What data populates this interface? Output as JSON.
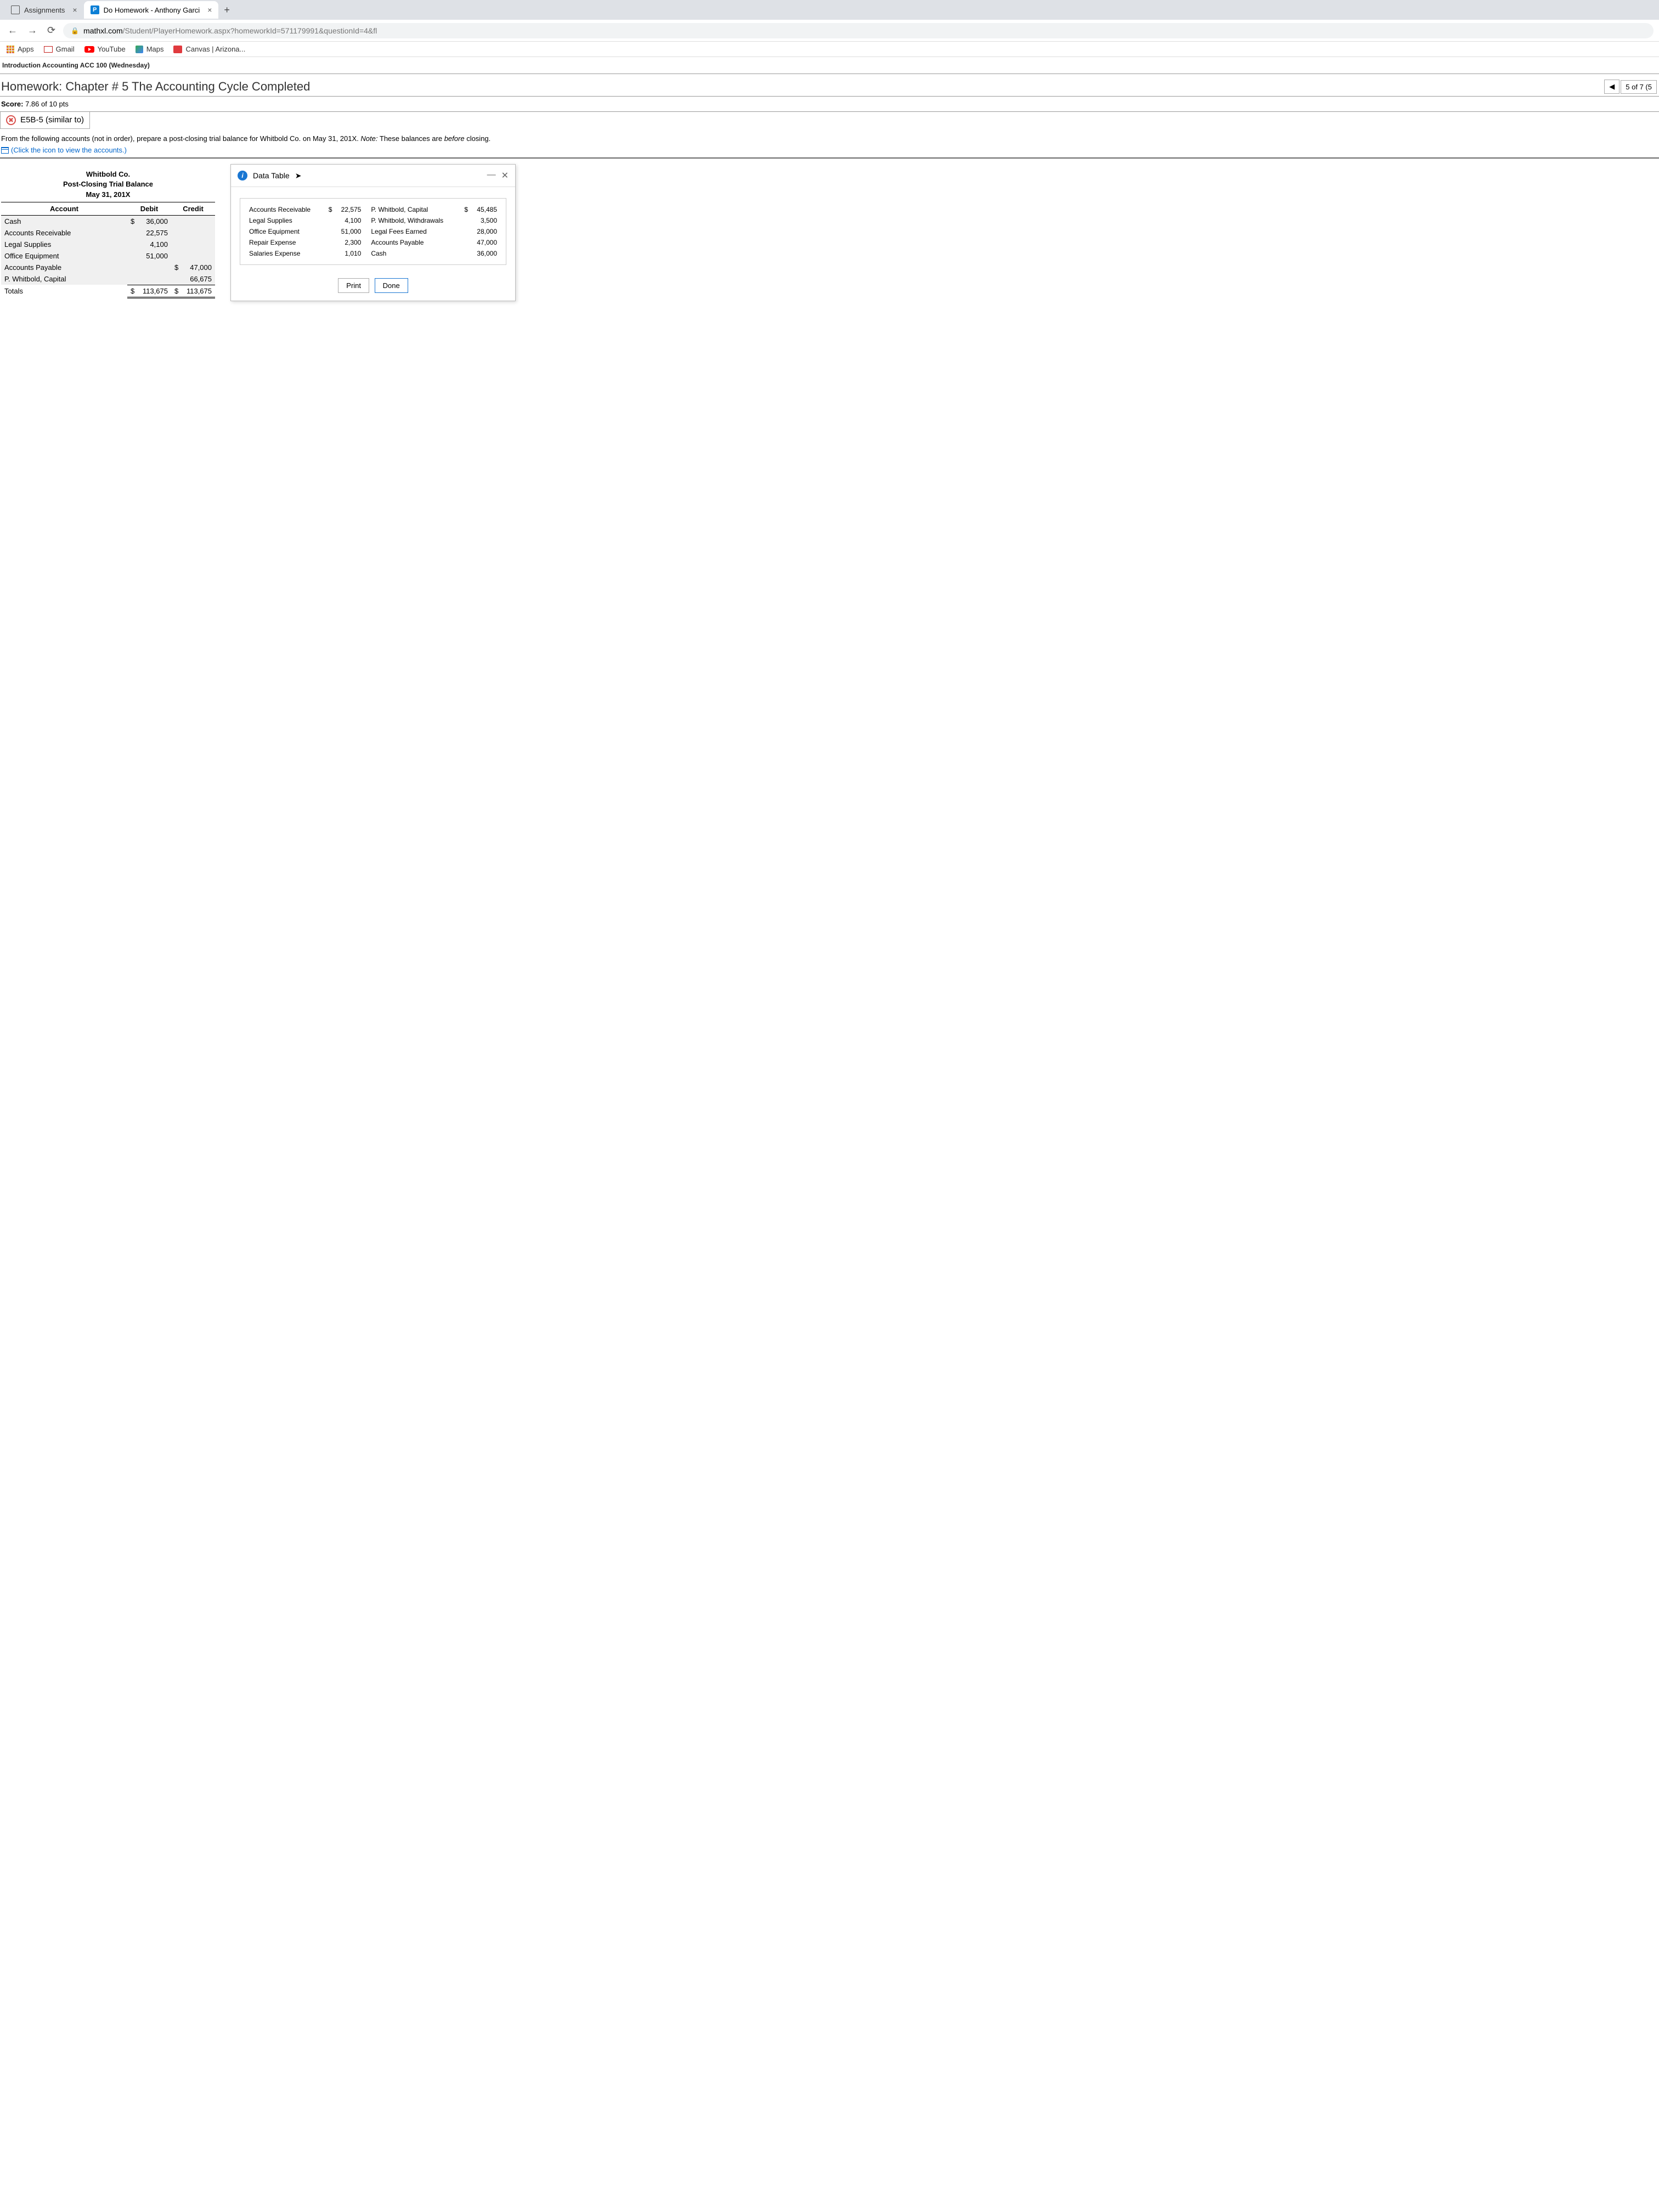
{
  "browser": {
    "tabs": [
      {
        "label": "Assignments"
      },
      {
        "label": "Do Homework - Anthony Garci"
      }
    ],
    "url_domain": "mathxl.com",
    "url_path": "/Student/PlayerHomework.aspx?homeworkId=571179991&questionId=4&fl",
    "bookmarks": {
      "apps": "Apps",
      "gmail": "Gmail",
      "youtube": "YouTube",
      "maps": "Maps",
      "canvas": "Canvas | Arizona..."
    }
  },
  "course_title": "Introduction Accounting ACC 100 (Wednesday)",
  "hw_title": "Homework: Chapter # 5 The Accounting Cycle Completed",
  "score_label": "Score:",
  "score_value": "7.86 of 10 pts",
  "nav_progress": "5 of 7 (5",
  "problem_id": "E5B-5 (similar to)",
  "instruction_main": "From the following accounts (not in order), prepare a post-closing trial balance for Whitbold Co. on May 31, 201X.",
  "instruction_note_label": "Note:",
  "instruction_note": "These balances are",
  "instruction_note_em": "before",
  "instruction_note_end": "closing.",
  "view_accounts_link": "(Click the icon to view the accounts.)",
  "trial_balance": {
    "company": "Whitbold Co.",
    "title": "Post-Closing Trial Balance",
    "date": "May 31, 201X",
    "col_account": "Account",
    "col_debit": "Debit",
    "col_credit": "Credit",
    "rows": [
      {
        "account": "Cash",
        "debit": "36,000",
        "credit": ""
      },
      {
        "account": "Accounts Receivable",
        "debit": "22,575",
        "credit": ""
      },
      {
        "account": "Legal Supplies",
        "debit": "4,100",
        "credit": ""
      },
      {
        "account": "Office Equipment",
        "debit": "51,000",
        "credit": ""
      },
      {
        "account": "Accounts Payable",
        "debit": "",
        "credit": "47,000"
      },
      {
        "account": "P. Whitbold, Capital",
        "debit": "",
        "credit": "66,675"
      }
    ],
    "totals_label": "Totals",
    "total_debit": "113,675",
    "total_credit": "113,675"
  },
  "modal": {
    "title": "Data Table",
    "rows": [
      {
        "l": "Accounts Receivable",
        "lv": "22,575",
        "r": "P. Whitbold, Capital",
        "rv": "45,485",
        "ld": "$",
        "rd": "$"
      },
      {
        "l": "Legal Supplies",
        "lv": "4,100",
        "r": "P. Whitbold, Withdrawals",
        "rv": "3,500"
      },
      {
        "l": "Office Equipment",
        "lv": "51,000",
        "r": "Legal Fees Earned",
        "rv": "28,000"
      },
      {
        "l": "Repair Expense",
        "lv": "2,300",
        "r": "Accounts Payable",
        "rv": "47,000"
      },
      {
        "l": "Salaries Expense",
        "lv": "1,010",
        "r": "Cash",
        "rv": "36,000"
      }
    ],
    "print": "Print",
    "done": "Done"
  }
}
